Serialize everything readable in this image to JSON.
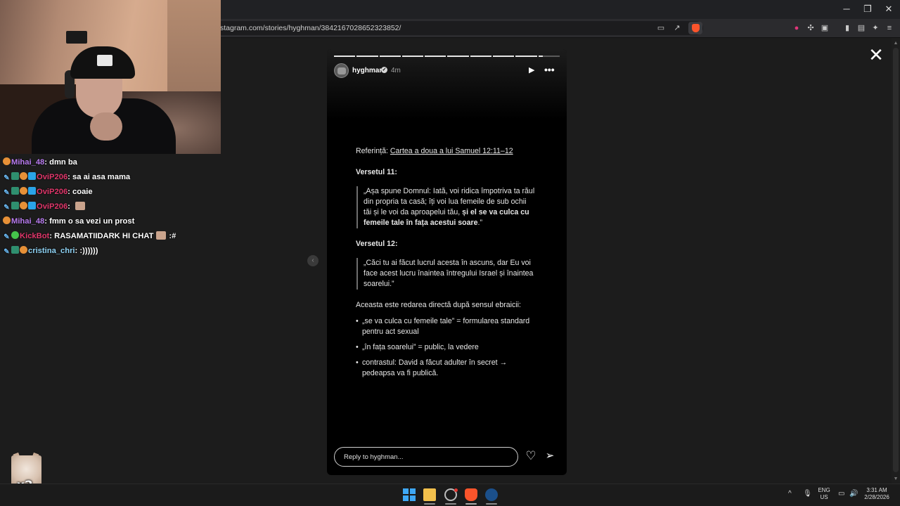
{
  "browser": {
    "url": "stagram.com/stories/hyghman/3842167028652323852/",
    "window_controls": {
      "minimize": "─",
      "restore": "❐",
      "close": "✕"
    }
  },
  "story": {
    "username": "hyghman",
    "age": "4m",
    "segments_total": 10,
    "segments_complete": 9,
    "reference_prefix": "Referință: ",
    "reference_link": "Cartea a doua a lui Samuel 12:11–12",
    "verse11_heading": "Versetul 11:",
    "verse11_text": "„Așa spune Domnul: Iată, voi ridica împotriva ta răul din propria ta casă; îți voi lua femeile de sub ochii tăi și le voi da aproapelui tău, ",
    "verse11_bold": "și el se va culca cu femeile tale în fața acestui soare",
    "verse11_end": ".”",
    "verse12_heading": "Versetul 12:",
    "verse12_text": "„Căci tu ai făcut lucrul acesta în ascuns, dar Eu voi face acest lucru înaintea întregului Israel și înaintea soarelui.”",
    "intro": "Aceasta este redarea directă după sensul ebraicii:",
    "bullets": [
      "„se va culca cu femeile tale” = formularea standard pentru act sexual",
      "„în fața soarelui” = public, la vedere",
      "contrastul: David a făcut adulter în secret → pedeapsa va fi publică."
    ],
    "reply_placeholder": "Reply to hyghman..."
  },
  "chat": [
    {
      "user": "Mihai_48",
      "color": "#b97cf0",
      "badges": [
        "paw"
      ],
      "text": "dmn ba"
    },
    {
      "user": "OviP206",
      "color": "#e0366a",
      "badges": [
        "pen",
        "grid",
        "paw",
        "cube"
      ],
      "text": "sa ai asa mama"
    },
    {
      "user": "OviP206",
      "color": "#e0366a",
      "badges": [
        "pen",
        "grid",
        "paw",
        "cube"
      ],
      "text": "coaie"
    },
    {
      "user": "OviP206",
      "color": "#e0366a",
      "badges": [
        "pen",
        "grid",
        "paw",
        "cube"
      ],
      "text": "",
      "emote": true
    },
    {
      "user": "Mihai_48",
      "color": "#b97cf0",
      "badges": [
        "paw"
      ],
      "text": "fmm o sa vezi un prost"
    },
    {
      "user": "KickBot",
      "color": "#e0366a",
      "badges": [
        "pen",
        "bot"
      ],
      "text": "RASAMATIIDARK HI CHAT",
      "emote": true,
      "suffix": ":#"
    },
    {
      "user": "cristina_chri",
      "color": "#8fd3f5",
      "badges": [
        "pen",
        "grid",
        "paw"
      ],
      "text": ":))))))"
    }
  ],
  "overlay": {
    "multiplier": "x2"
  },
  "taskbar": {
    "lang_top": "ENG",
    "lang_bottom": "US",
    "time": "3:31 AM",
    "date": "2/28/2026"
  },
  "icons": [
    "close-icon",
    "play-icon",
    "more-icon",
    "heart-icon",
    "send-icon",
    "chevron-left-icon",
    "verified-icon",
    "windows-start-icon",
    "folder-icon",
    "chrome-icon",
    "brave-icon",
    "steam-icon"
  ]
}
